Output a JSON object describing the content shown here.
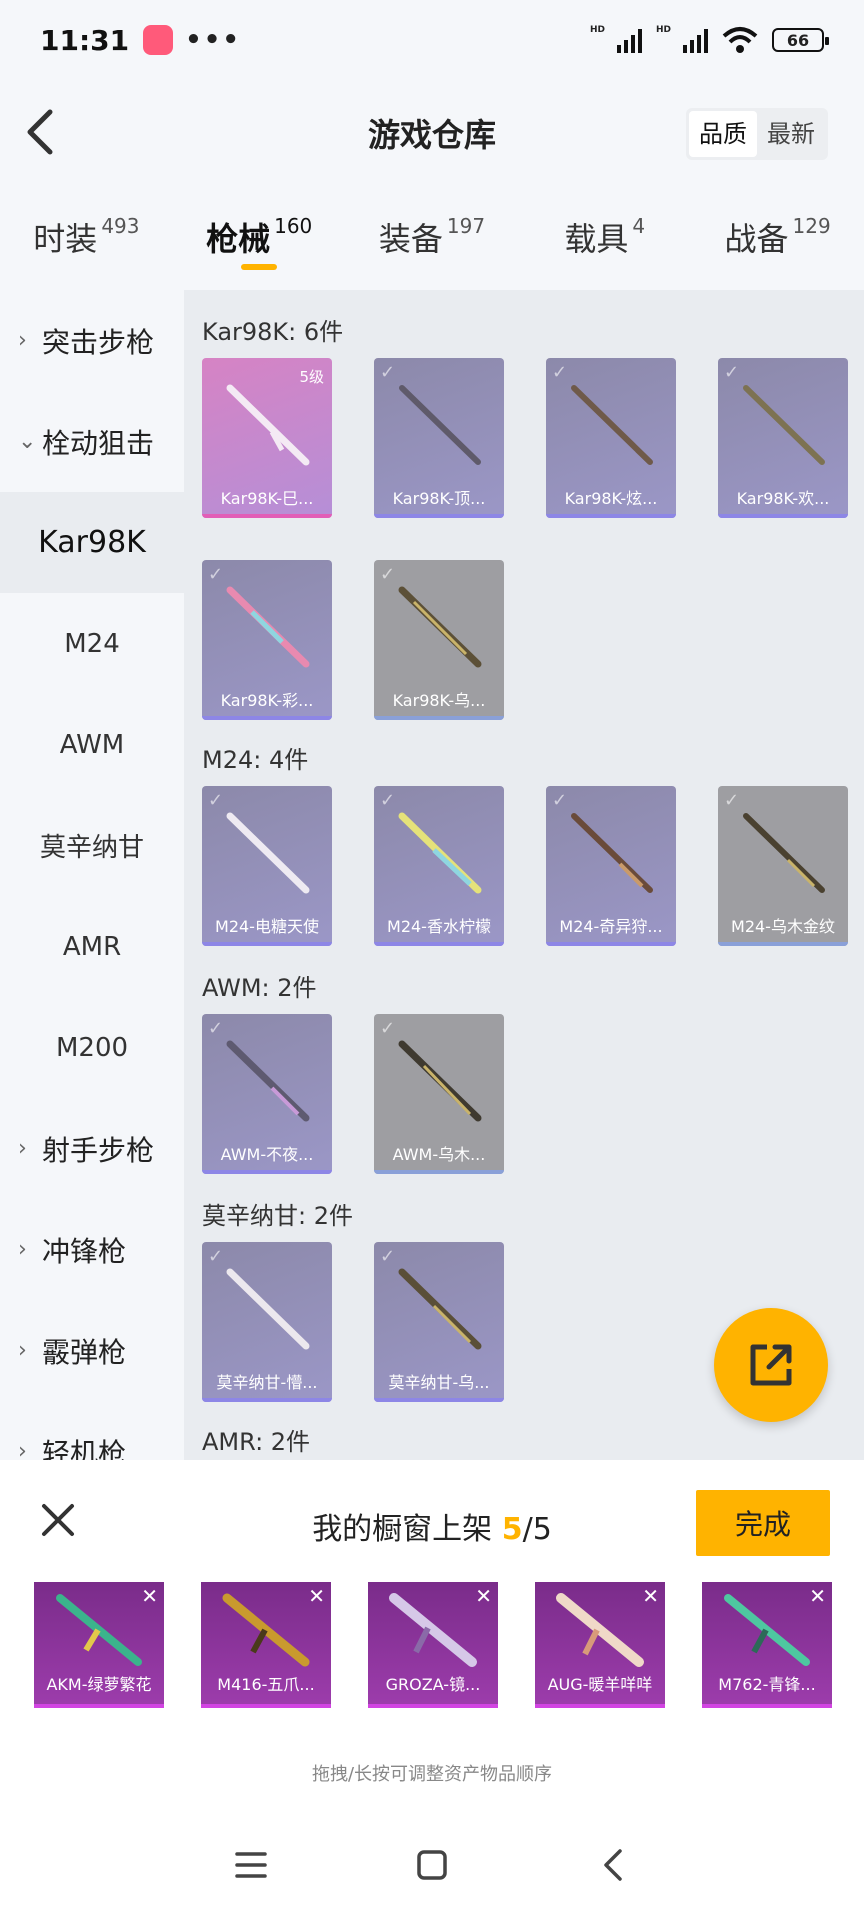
{
  "status": {
    "time": "11:31",
    "app_badge": "bilibili",
    "dots": "•••",
    "hd1": "HD",
    "hd2": "HD",
    "battery": "66"
  },
  "header": {
    "title": "游戏仓库",
    "sort": [
      "品质",
      "最新"
    ],
    "sort_active": 0
  },
  "categories": [
    {
      "label": "时装",
      "count": "493"
    },
    {
      "label": "枪械",
      "count": "160"
    },
    {
      "label": "装备",
      "count": "197"
    },
    {
      "label": "载具",
      "count": "4"
    },
    {
      "label": "战备",
      "count": "129"
    }
  ],
  "active_category": 1,
  "sidebar": {
    "items": [
      {
        "label": "突击步枪",
        "type": "group",
        "chevron": "›"
      },
      {
        "label": "栓动狙击",
        "type": "group",
        "chevron": "⌄"
      },
      {
        "label": "Kar98K",
        "type": "active"
      },
      {
        "label": "M24",
        "type": "sub"
      },
      {
        "label": "AWM",
        "type": "sub"
      },
      {
        "label": "莫辛纳甘",
        "type": "sub"
      },
      {
        "label": "AMR",
        "type": "sub"
      },
      {
        "label": "M200",
        "type": "sub"
      },
      {
        "label": "射手步枪",
        "type": "group",
        "chevron": "›"
      },
      {
        "label": "冲锋枪",
        "type": "group",
        "chevron": "›"
      },
      {
        "label": "霰弹枪",
        "type": "group",
        "chevron": "›"
      },
      {
        "label": "轻机枪",
        "type": "group",
        "chevron": "›"
      }
    ]
  },
  "sections": [
    {
      "title": "Kar98K: 6件",
      "items": [
        {
          "name": "Kar98K-巳...",
          "level": "5级",
          "tier": "pink"
        },
        {
          "name": "Kar98K-顶...",
          "tier": "purple"
        },
        {
          "name": "Kar98K-炫...",
          "tier": "purple"
        },
        {
          "name": "Kar98K-欢...",
          "tier": "purple"
        },
        {
          "name": "Kar98K-彩...",
          "tier": "purple"
        },
        {
          "name": "Kar98K-乌...",
          "tier": "grey"
        }
      ]
    },
    {
      "title": "M24: 4件",
      "items": [
        {
          "name": "M24-电糖天使",
          "tier": "purple"
        },
        {
          "name": "M24-香水柠檬",
          "tier": "purple"
        },
        {
          "name": "M24-奇异狩...",
          "tier": "purple"
        },
        {
          "name": "M24-乌木金纹",
          "tier": "grey"
        }
      ]
    },
    {
      "title": "AWM: 2件",
      "items": [
        {
          "name": "AWM-不夜...",
          "tier": "purple"
        },
        {
          "name": "AWM-乌木...",
          "tier": "grey"
        }
      ]
    },
    {
      "title": "莫辛纳甘: 2件",
      "items": [
        {
          "name": "莫辛纳甘-懵...",
          "tier": "purple"
        },
        {
          "name": "莫辛纳甘-乌...",
          "tier": "purple"
        }
      ]
    },
    {
      "title": "AMR: 2件",
      "items": []
    }
  ],
  "panel": {
    "title_prefix": "我的橱窗上架 ",
    "current": "5",
    "separator": "/",
    "total": "5",
    "done_label": "完成",
    "showcase": [
      {
        "name": "AKM-绿萝繁花"
      },
      {
        "name": "M416-五爪..."
      },
      {
        "name": "GROZA-镜..."
      },
      {
        "name": "AUG-暖羊咩咩"
      },
      {
        "name": "M762-青锋..."
      }
    ],
    "hint": "拖拽/长按可调整资产物品顺序"
  },
  "colors": {
    "accent": "#ffb300",
    "tier_pink": "#e25eb7",
    "tier_purple": "#8d86e6",
    "showcase_purple": "#9c3cab"
  }
}
